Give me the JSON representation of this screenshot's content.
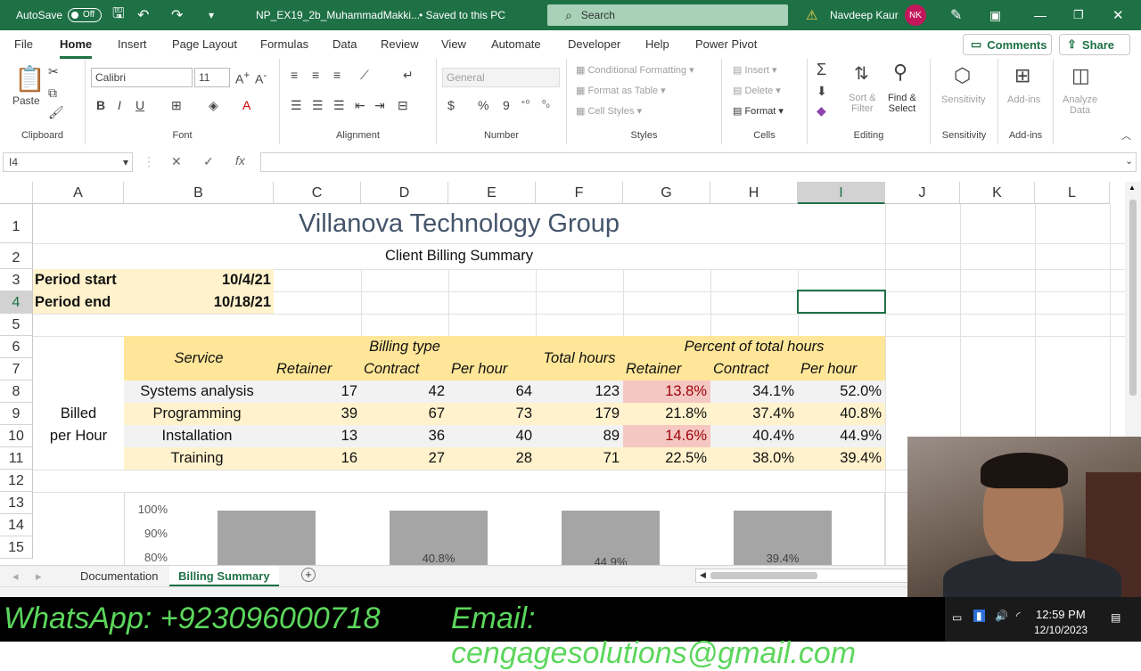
{
  "titlebar": {
    "autosave_label": "AutoSave",
    "autosave_state": "Off",
    "filename": "NP_EX19_2b_MuhammadMakki...",
    "save_status": "• Saved to this PC",
    "search_placeholder": "Search",
    "user_name": "Navdeep Kaur",
    "user_initials": "NK",
    "accent_color": "#1e7145"
  },
  "menu": {
    "items": [
      "File",
      "Home",
      "Insert",
      "Page Layout",
      "Formulas",
      "Data",
      "Review",
      "View",
      "Automate",
      "Developer",
      "Help",
      "Power Pivot"
    ],
    "active": "Home",
    "comments_label": "Comments",
    "share_label": "Share"
  },
  "ribbon": {
    "clipboard": {
      "paste": "Paste",
      "label": "Clipboard"
    },
    "font": {
      "name": "Calibri",
      "size": "11",
      "label": "Font"
    },
    "alignment": {
      "label": "Alignment"
    },
    "number": {
      "format": "General",
      "label": "Number",
      "currency": "$",
      "percent": "%",
      "comma": "9"
    },
    "styles": {
      "conditional": "Conditional Formatting",
      "table": "Format as Table",
      "cell": "Cell Styles",
      "label": "Styles"
    },
    "cells": {
      "insert": "Insert",
      "delete": "Delete",
      "format": "Format",
      "label": "Cells"
    },
    "editing": {
      "sort1": "Sort &",
      "sort2": "Filter",
      "find1": "Find &",
      "find2": "Select",
      "label": "Editing"
    },
    "sensitivity": {
      "btn": "Sensitivity",
      "label": "Sensitivity"
    },
    "addins": {
      "btn": "Add-ins",
      "label": "Add-ins"
    },
    "analyze": {
      "btn1": "Analyze",
      "btn2": "Data"
    }
  },
  "formula_bar": {
    "name_box": "I4",
    "formula": ""
  },
  "columns": [
    "A",
    "B",
    "C",
    "D",
    "E",
    "F",
    "G",
    "H",
    "I",
    "J",
    "K",
    "L"
  ],
  "selected_column": "I",
  "rows": [
    "1",
    "2",
    "3",
    "4",
    "5",
    "6",
    "7",
    "8",
    "9",
    "10",
    "11",
    "12",
    "13",
    "14",
    "15"
  ],
  "sheet": {
    "title": "Villanova Technology Group",
    "subtitle": "Client Billing Summary",
    "period_start_label": "Period start",
    "period_start": "10/4/21",
    "period_end_label": "Period end",
    "period_end": "10/18/21",
    "hdr_service": "Service",
    "hdr_billing_type": "Billing type",
    "hdr_total_hours": "Total hours",
    "hdr_percent": "Percent of total hours",
    "sub_retainer": "Retainer",
    "sub_contract": "Contract",
    "sub_perhour": "Per hour",
    "side_label_1": "Billed",
    "side_label_2": "per Hour",
    "data_rows": [
      {
        "service": "Systems analysis",
        "retainer": "17",
        "contract": "42",
        "perhour": "64",
        "total": "123",
        "p_ret": "13.8%",
        "p_con": "34.1%",
        "p_ph": "52.0%"
      },
      {
        "service": "Programming",
        "retainer": "39",
        "contract": "67",
        "perhour": "73",
        "total": "179",
        "p_ret": "21.8%",
        "p_con": "37.4%",
        "p_ph": "40.8%"
      },
      {
        "service": "Installation",
        "retainer": "13",
        "contract": "36",
        "perhour": "40",
        "total": "89",
        "p_ret": "14.6%",
        "p_con": "40.4%",
        "p_ph": "44.9%"
      },
      {
        "service": "Training",
        "retainer": "16",
        "contract": "27",
        "perhour": "28",
        "total": "71",
        "p_ret": "22.5%",
        "p_con": "38.0%",
        "p_ph": "39.4%"
      }
    ],
    "highlight_color": "#f4c7c3"
  },
  "chart_data": {
    "type": "bar",
    "y_ticks": [
      "100%",
      "90%",
      "80%"
    ],
    "bar_labels": [
      "",
      "40.8%",
      "44.9%",
      "39.4%"
    ],
    "ylim": [
      0.8,
      1.0
    ]
  },
  "tabs": {
    "items": [
      "Documentation",
      "Billing Summary"
    ],
    "active": "Billing Summary"
  },
  "overlay": {
    "whatsapp": "WhatsApp: +923096000718",
    "email": "Email: cengagesolutions@gmail.com"
  },
  "taskbar": {
    "time": "12:59 PM",
    "date": "12/10/2023"
  }
}
